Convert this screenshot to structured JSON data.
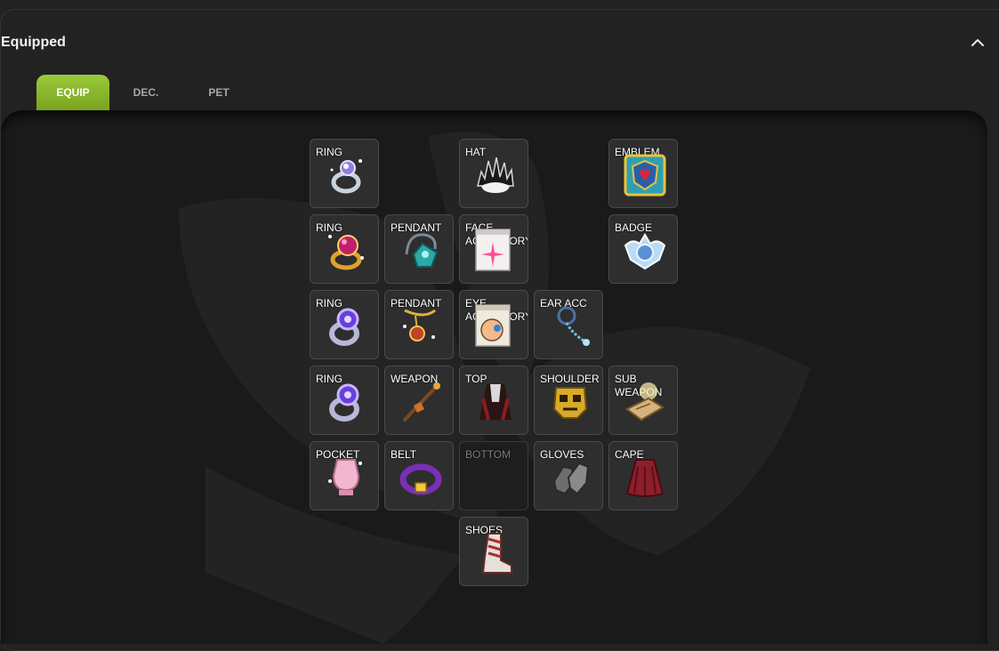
{
  "section": {
    "title": "Equipped"
  },
  "tabs": [
    {
      "label": "EQUIP",
      "active": true
    },
    {
      "label": "DEC.",
      "active": false
    },
    {
      "label": "PET",
      "active": false
    }
  ],
  "slots": {
    "ring1": {
      "label": "RING",
      "icon": "ring-silver-gem-icon"
    },
    "hat": {
      "label": "HAT",
      "icon": "spiked-hat-icon"
    },
    "emblem": {
      "label": "EMBLEM",
      "icon": "emblem-shield-icon"
    },
    "ring2": {
      "label": "RING",
      "icon": "ring-ruby-icon"
    },
    "pendant1": {
      "label": "PENDANT",
      "icon": "pendant-teal-gem-icon"
    },
    "face_accessory": {
      "label": "FACE ACCESSORY",
      "icon": "face-accessory-card-icon"
    },
    "badge": {
      "label": "BADGE",
      "icon": "badge-crystal-icon"
    },
    "ring3": {
      "label": "RING",
      "icon": "ring-purple-icon"
    },
    "pendant2": {
      "label": "PENDANT",
      "icon": "pendant-gold-chain-icon"
    },
    "eye_accessory": {
      "label": "EYE ACCESSORY",
      "icon": "eye-accessory-card-icon"
    },
    "earring": {
      "label": "EAR ACC",
      "icon": "earring-chain-icon"
    },
    "ring4": {
      "label": "RING",
      "icon": "ring-purple-icon"
    },
    "weapon": {
      "label": "WEAPON",
      "icon": "staff-weapon-icon"
    },
    "top": {
      "label": "TOP",
      "icon": "coat-top-icon"
    },
    "shoulder": {
      "label": "SHOULDER",
      "icon": "skull-shoulder-icon"
    },
    "sub_weapon": {
      "label": "SUB WEAPON",
      "icon": "scroll-sub-weapon-icon"
    },
    "pocket": {
      "label": "POCKET",
      "icon": "pocket-vase-icon"
    },
    "belt": {
      "label": "BELT",
      "icon": "belt-icon"
    },
    "bottom": {
      "label": "BOTTOM",
      "icon": ""
    },
    "gloves": {
      "label": "GLOVES",
      "icon": "gloves-icon"
    },
    "cape": {
      "label": "CAPE",
      "icon": "cape-icon"
    },
    "shoes": {
      "label": "SHOES",
      "icon": "boots-icon"
    }
  },
  "colors": {
    "accent": "#8dba2c",
    "background": "#222222",
    "panel": "#1a1a1a"
  }
}
